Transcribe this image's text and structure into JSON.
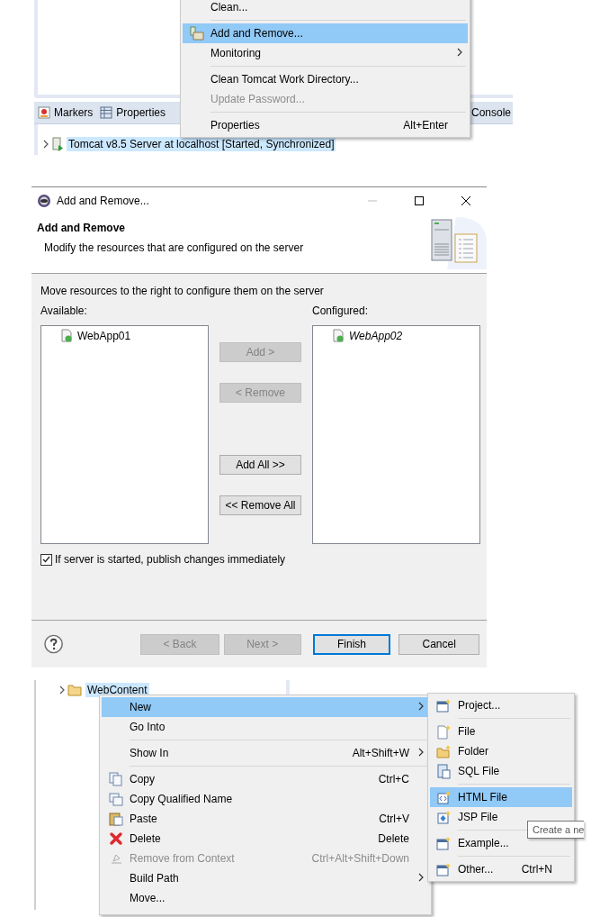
{
  "server_view": {
    "tabs": [
      {
        "label": "Markers"
      },
      {
        "label": "Properties"
      },
      {
        "label": "Console"
      }
    ],
    "servers": [
      {
        "label": "Tomcat v8.5 Server at localhost  [Started, Synchronized]",
        "selected": true,
        "expanded": false
      }
    ],
    "context_menu": {
      "items": [
        {
          "kind": "item",
          "label": "Clean...",
          "selected": false,
          "disabled": false,
          "submenu": false
        },
        {
          "kind": "separator"
        },
        {
          "kind": "item",
          "label": "Add and Remove...",
          "selected": true,
          "disabled": false,
          "submenu": false
        },
        {
          "kind": "item",
          "label": "Monitoring",
          "selected": false,
          "disabled": false,
          "submenu": true
        },
        {
          "kind": "separator"
        },
        {
          "kind": "item",
          "label": "Clean Tomcat Work Directory...",
          "selected": false,
          "disabled": false,
          "submenu": false
        },
        {
          "kind": "item",
          "label": "Update Password...",
          "selected": false,
          "disabled": true,
          "submenu": false
        },
        {
          "kind": "separator"
        },
        {
          "kind": "item",
          "label": "Properties",
          "shortcut": "Alt+Enter",
          "selected": false,
          "disabled": false,
          "submenu": false
        }
      ]
    }
  },
  "dialog": {
    "title": "Add and Remove...",
    "heading": "Add and Remove",
    "description": "Modify the resources that are configured on the server",
    "instruction": "Move resources to the right to configure them on the server",
    "available": {
      "label": "Available:",
      "items": [
        {
          "label": "WebApp01"
        }
      ]
    },
    "configured": {
      "label": "Configured:",
      "items": [
        {
          "label": "WebApp02"
        }
      ]
    },
    "move_buttons": [
      {
        "label": "Add >",
        "disabled": true
      },
      {
        "label": "< Remove",
        "disabled": true
      },
      {
        "label": "Add All >>",
        "disabled": false
      },
      {
        "label": "<< Remove All",
        "disabled": false
      }
    ],
    "publish_checkbox": {
      "label": "If server is started, publish changes immediately",
      "checked": true
    },
    "buttons": [
      {
        "label": "< Back",
        "disabled": true,
        "default": false
      },
      {
        "label": "Next >",
        "disabled": true,
        "default": false
      },
      {
        "label": "Finish",
        "disabled": false,
        "default": true
      },
      {
        "label": "Cancel",
        "disabled": false,
        "default": false
      }
    ]
  },
  "project_explorer": {
    "tree": [
      {
        "label": "WebContent",
        "selected": true,
        "expanded": false
      }
    ],
    "context_menu": {
      "items": [
        {
          "kind": "item",
          "label": "New",
          "selected": true,
          "disabled": false,
          "submenu": true
        },
        {
          "kind": "item",
          "label": "Go Into",
          "selected": false,
          "disabled": false,
          "submenu": false
        },
        {
          "kind": "separator"
        },
        {
          "kind": "item",
          "label": "Show In",
          "shortcut": "Alt+Shift+W",
          "selected": false,
          "disabled": false,
          "submenu": true
        },
        {
          "kind": "separator"
        },
        {
          "kind": "item",
          "label": "Copy",
          "shortcut": "Ctrl+C",
          "selected": false,
          "disabled": false,
          "submenu": false
        },
        {
          "kind": "item",
          "label": "Copy Qualified Name",
          "selected": false,
          "disabled": false,
          "submenu": false
        },
        {
          "kind": "item",
          "label": "Paste",
          "shortcut": "Ctrl+V",
          "selected": false,
          "disabled": false,
          "submenu": false
        },
        {
          "kind": "item",
          "label": "Delete",
          "shortcut": "Delete",
          "selected": false,
          "disabled": false,
          "submenu": false
        },
        {
          "kind": "item",
          "label": "Remove from Context",
          "shortcut": "Ctrl+Alt+Shift+Down",
          "selected": false,
          "disabled": true,
          "submenu": false
        },
        {
          "kind": "item",
          "label": "Build Path",
          "selected": false,
          "disabled": false,
          "submenu": true
        },
        {
          "kind": "item",
          "label": "Move...",
          "selected": false,
          "disabled": false,
          "submenu": false
        }
      ]
    },
    "submenu": {
      "items": [
        {
          "kind": "item",
          "label": "Project...",
          "selected": false,
          "disabled": false,
          "submenu": false
        },
        {
          "kind": "separator"
        },
        {
          "kind": "item",
          "label": "File",
          "selected": false,
          "disabled": false,
          "submenu": false
        },
        {
          "kind": "item",
          "label": "Folder",
          "selected": false,
          "disabled": false,
          "submenu": false
        },
        {
          "kind": "item",
          "label": "SQL File",
          "selected": false,
          "disabled": false,
          "submenu": false
        },
        {
          "kind": "separator"
        },
        {
          "kind": "item",
          "label": "HTML File",
          "selected": true,
          "disabled": false,
          "submenu": false
        },
        {
          "kind": "item",
          "label": "JSP File",
          "selected": false,
          "disabled": false,
          "submenu": false
        },
        {
          "kind": "separator"
        },
        {
          "kind": "item",
          "label": "Example...",
          "selected": false,
          "disabled": false,
          "submenu": false
        },
        {
          "kind": "separator"
        },
        {
          "kind": "item",
          "label": "Other...",
          "shortcut": "Ctrl+N",
          "selected": false,
          "disabled": false,
          "submenu": false
        }
      ]
    },
    "tooltip": "Create a ne"
  }
}
